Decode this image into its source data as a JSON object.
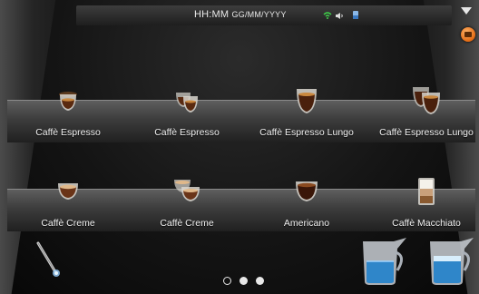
{
  "status_bar": {
    "time": "HH:MM",
    "date": "GG/MM/YYYY",
    "icons": [
      "wifi-icon",
      "speaker-icon",
      "cup-status-icon"
    ]
  },
  "accent_color": "#e46a12",
  "drinks_top": [
    {
      "label": "Caffè Espresso",
      "icon": "espresso-single-icon"
    },
    {
      "label": "Caffè Espresso",
      "icon": "espresso-double-icon"
    },
    {
      "label": "Caffè Espresso Lungo",
      "icon": "espresso-lungo-single-icon"
    },
    {
      "label": "Caffè Espresso Lungo",
      "icon": "espresso-lungo-double-icon"
    }
  ],
  "drinks_bottom": [
    {
      "label": "Caffè Creme",
      "icon": "creme-single-icon"
    },
    {
      "label": "Caffè Creme",
      "icon": "creme-double-icon"
    },
    {
      "label": "Americano",
      "icon": "americano-icon"
    },
    {
      "label": "Caffè Macchiato",
      "icon": "macchiato-icon"
    }
  ],
  "bottom_tools": [
    "steam-wand-icon",
    "milk-jug-icon",
    "milk-foam-jug-icon"
  ],
  "pager": {
    "pages": 3,
    "current": 1
  }
}
